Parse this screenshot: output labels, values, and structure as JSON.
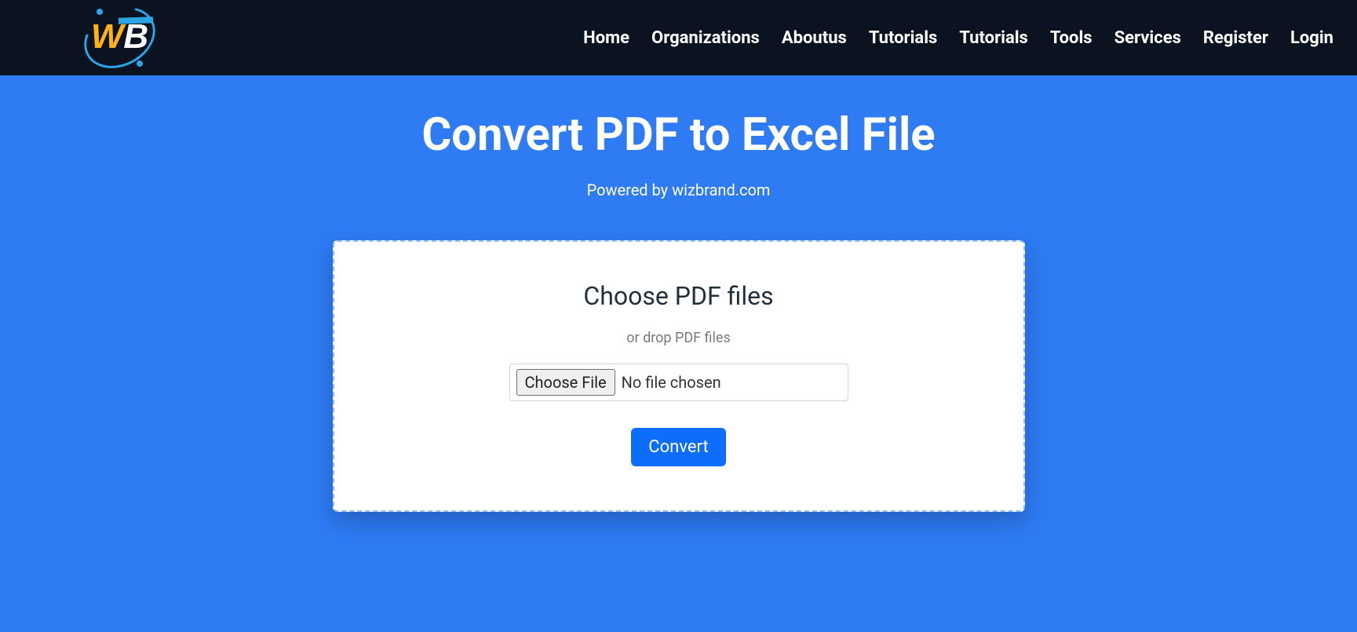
{
  "nav": {
    "items": [
      "Home",
      "Organizations",
      "Aboutus",
      "Tutorials",
      "Tutorials",
      "Tools",
      "Services",
      "Register",
      "Login"
    ]
  },
  "hero": {
    "title": "Convert PDF to Excel File",
    "subtitle": "Powered by wizbrand.com"
  },
  "card": {
    "heading": "Choose PDF files",
    "sub": "or drop PDF files",
    "choose_label": "Choose File",
    "file_status": "No file chosen",
    "convert_label": "Convert"
  }
}
